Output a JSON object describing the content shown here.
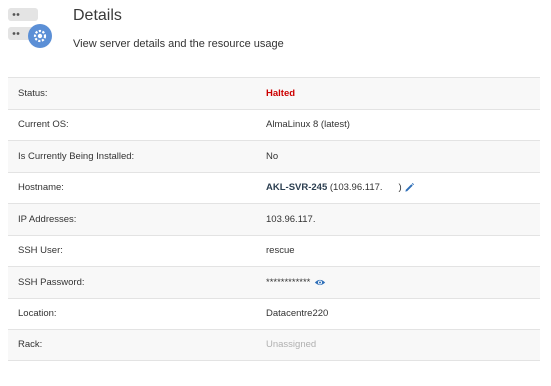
{
  "header": {
    "title": "Details",
    "subtitle": "View server details and the resource usage",
    "icon": "server-gear-icon"
  },
  "colors": {
    "status_halted": "#cc0000",
    "icon_blue": "#5b8fd6",
    "muted": "#b0b0b0",
    "row_alt": "#f8f8f8"
  },
  "details": {
    "status": {
      "label": "Status:",
      "value": "Halted"
    },
    "os": {
      "label": "Current OS:",
      "value": "AlmaLinux 8 (latest)"
    },
    "installing": {
      "label": "Is Currently Being Installed:",
      "value": "No"
    },
    "hostname": {
      "label": "Hostname:",
      "name": "AKL-SVR-245",
      "ip_part": " (103.96.117.",
      "ip_end": ")",
      "edit_icon": "pencil-icon"
    },
    "ip": {
      "label": "IP Addresses:",
      "value": "103.96.117."
    },
    "ssh_user": {
      "label": "SSH User:",
      "value": "rescue"
    },
    "ssh_password": {
      "label": "SSH Password:",
      "value": "************",
      "reveal_icon": "eye-icon"
    },
    "location": {
      "label": "Location:",
      "value": "Datacentre220"
    },
    "rack": {
      "label": "Rack:",
      "value": "Unassigned"
    }
  }
}
